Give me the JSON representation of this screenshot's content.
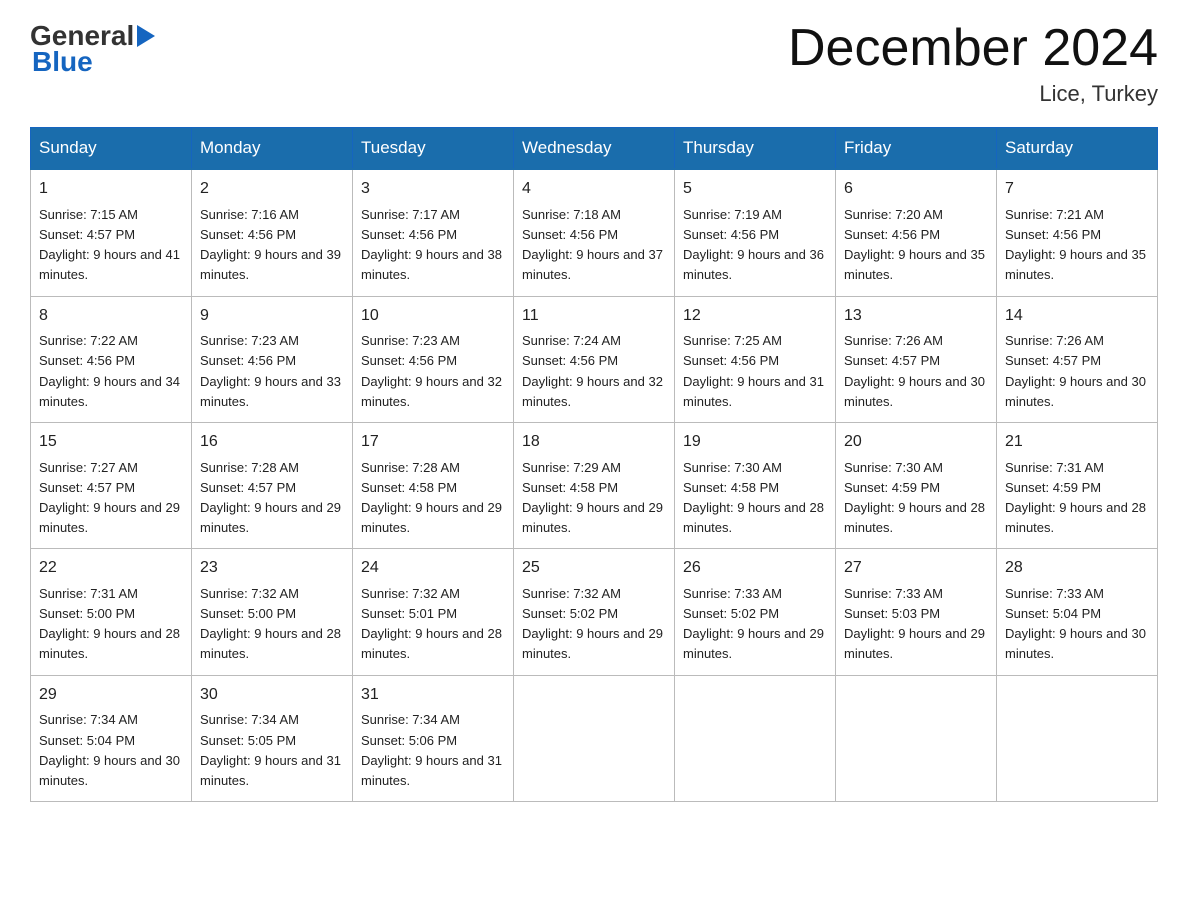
{
  "header": {
    "logo_general": "General",
    "logo_blue": "Blue",
    "month_title": "December 2024",
    "location": "Lice, Turkey"
  },
  "calendar": {
    "days_of_week": [
      "Sunday",
      "Monday",
      "Tuesday",
      "Wednesday",
      "Thursday",
      "Friday",
      "Saturday"
    ],
    "weeks": [
      [
        {
          "day": "1",
          "sunrise": "7:15 AM",
          "sunset": "4:57 PM",
          "daylight": "9 hours and 41 minutes."
        },
        {
          "day": "2",
          "sunrise": "7:16 AM",
          "sunset": "4:56 PM",
          "daylight": "9 hours and 39 minutes."
        },
        {
          "day": "3",
          "sunrise": "7:17 AM",
          "sunset": "4:56 PM",
          "daylight": "9 hours and 38 minutes."
        },
        {
          "day": "4",
          "sunrise": "7:18 AM",
          "sunset": "4:56 PM",
          "daylight": "9 hours and 37 minutes."
        },
        {
          "day": "5",
          "sunrise": "7:19 AM",
          "sunset": "4:56 PM",
          "daylight": "9 hours and 36 minutes."
        },
        {
          "day": "6",
          "sunrise": "7:20 AM",
          "sunset": "4:56 PM",
          "daylight": "9 hours and 35 minutes."
        },
        {
          "day": "7",
          "sunrise": "7:21 AM",
          "sunset": "4:56 PM",
          "daylight": "9 hours and 35 minutes."
        }
      ],
      [
        {
          "day": "8",
          "sunrise": "7:22 AM",
          "sunset": "4:56 PM",
          "daylight": "9 hours and 34 minutes."
        },
        {
          "day": "9",
          "sunrise": "7:23 AM",
          "sunset": "4:56 PM",
          "daylight": "9 hours and 33 minutes."
        },
        {
          "day": "10",
          "sunrise": "7:23 AM",
          "sunset": "4:56 PM",
          "daylight": "9 hours and 32 minutes."
        },
        {
          "day": "11",
          "sunrise": "7:24 AM",
          "sunset": "4:56 PM",
          "daylight": "9 hours and 32 minutes."
        },
        {
          "day": "12",
          "sunrise": "7:25 AM",
          "sunset": "4:56 PM",
          "daylight": "9 hours and 31 minutes."
        },
        {
          "day": "13",
          "sunrise": "7:26 AM",
          "sunset": "4:57 PM",
          "daylight": "9 hours and 30 minutes."
        },
        {
          "day": "14",
          "sunrise": "7:26 AM",
          "sunset": "4:57 PM",
          "daylight": "9 hours and 30 minutes."
        }
      ],
      [
        {
          "day": "15",
          "sunrise": "7:27 AM",
          "sunset": "4:57 PM",
          "daylight": "9 hours and 29 minutes."
        },
        {
          "day": "16",
          "sunrise": "7:28 AM",
          "sunset": "4:57 PM",
          "daylight": "9 hours and 29 minutes."
        },
        {
          "day": "17",
          "sunrise": "7:28 AM",
          "sunset": "4:58 PM",
          "daylight": "9 hours and 29 minutes."
        },
        {
          "day": "18",
          "sunrise": "7:29 AM",
          "sunset": "4:58 PM",
          "daylight": "9 hours and 29 minutes."
        },
        {
          "day": "19",
          "sunrise": "7:30 AM",
          "sunset": "4:58 PM",
          "daylight": "9 hours and 28 minutes."
        },
        {
          "day": "20",
          "sunrise": "7:30 AM",
          "sunset": "4:59 PM",
          "daylight": "9 hours and 28 minutes."
        },
        {
          "day": "21",
          "sunrise": "7:31 AM",
          "sunset": "4:59 PM",
          "daylight": "9 hours and 28 minutes."
        }
      ],
      [
        {
          "day": "22",
          "sunrise": "7:31 AM",
          "sunset": "5:00 PM",
          "daylight": "9 hours and 28 minutes."
        },
        {
          "day": "23",
          "sunrise": "7:32 AM",
          "sunset": "5:00 PM",
          "daylight": "9 hours and 28 minutes."
        },
        {
          "day": "24",
          "sunrise": "7:32 AM",
          "sunset": "5:01 PM",
          "daylight": "9 hours and 28 minutes."
        },
        {
          "day": "25",
          "sunrise": "7:32 AM",
          "sunset": "5:02 PM",
          "daylight": "9 hours and 29 minutes."
        },
        {
          "day": "26",
          "sunrise": "7:33 AM",
          "sunset": "5:02 PM",
          "daylight": "9 hours and 29 minutes."
        },
        {
          "day": "27",
          "sunrise": "7:33 AM",
          "sunset": "5:03 PM",
          "daylight": "9 hours and 29 minutes."
        },
        {
          "day": "28",
          "sunrise": "7:33 AM",
          "sunset": "5:04 PM",
          "daylight": "9 hours and 30 minutes."
        }
      ],
      [
        {
          "day": "29",
          "sunrise": "7:34 AM",
          "sunset": "5:04 PM",
          "daylight": "9 hours and 30 minutes."
        },
        {
          "day": "30",
          "sunrise": "7:34 AM",
          "sunset": "5:05 PM",
          "daylight": "9 hours and 31 minutes."
        },
        {
          "day": "31",
          "sunrise": "7:34 AM",
          "sunset": "5:06 PM",
          "daylight": "9 hours and 31 minutes."
        },
        null,
        null,
        null,
        null
      ]
    ],
    "labels": {
      "sunrise": "Sunrise:",
      "sunset": "Sunset:",
      "daylight": "Daylight:"
    }
  }
}
